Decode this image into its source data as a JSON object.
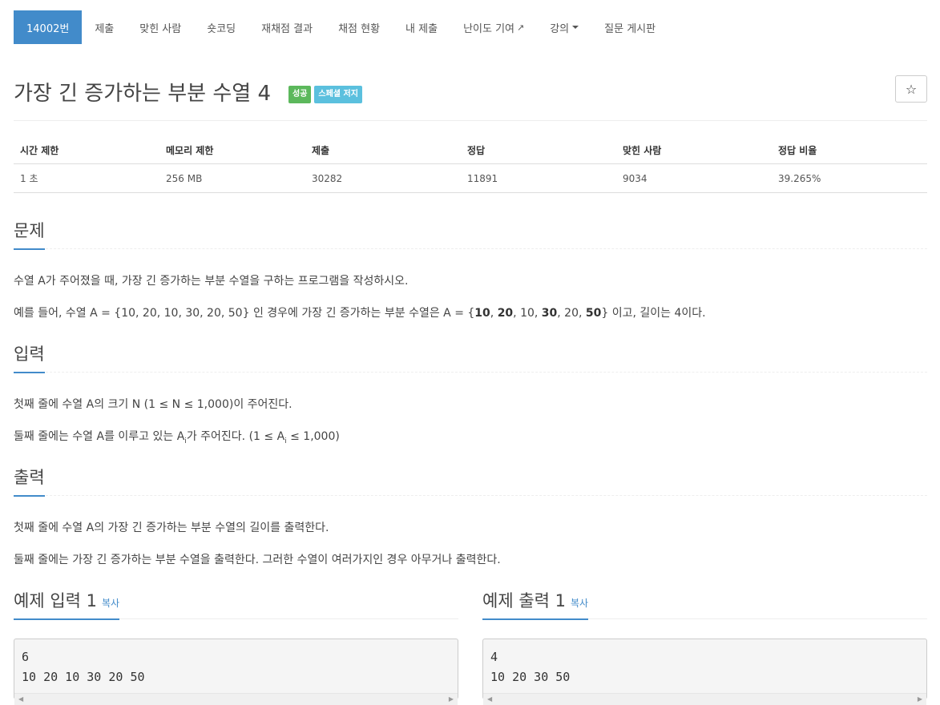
{
  "nav": {
    "problem_number": "14002번",
    "submit": "제출",
    "solvers": "맞힌 사람",
    "shortest": "숏코딩",
    "rejudge": "재채점 결과",
    "status": "채점 현황",
    "my_submissions": "내 제출",
    "difficulty": "난이도 기여",
    "lecture": "강의",
    "board": "질문 게시판"
  },
  "problem": {
    "title": "가장 긴 증가하는 부분 수열 4",
    "badge_success": "성공",
    "badge_special": "스페셜 저지"
  },
  "info_table": {
    "headers": [
      "시간 제한",
      "메모리 제한",
      "제출",
      "정답",
      "맞힌 사람",
      "정답 비율"
    ],
    "values": [
      "1 초",
      "256 MB",
      "30282",
      "11891",
      "9034",
      "39.265%"
    ]
  },
  "sections": {
    "description_title": "문제",
    "description_p1": "수열 A가 주어졌을 때, 가장 긴 증가하는 부분 수열을 구하는 프로그램을 작성하시오.",
    "description_p2_pre": "예를 들어, 수열 A = {10, 20, 10, 30, 20, 50} 인 경우에 가장 긴 증가하는 부분 수열은 A = {",
    "description_p2_b1": "10",
    "description_p2_s1": ", ",
    "description_p2_b2": "20",
    "description_p2_s2": ", 10, ",
    "description_p2_b3": "30",
    "description_p2_s3": ", 20, ",
    "description_p2_b4": "50",
    "description_p2_post": "} 이고, 길이는 4이다.",
    "input_title": "입력",
    "input_p1": "첫째 줄에 수열 A의 크기 N (1 ≤ N ≤ 1,000)이 주어진다.",
    "input_p2_pre": "둘째 줄에는 수열 A를 이루고 있는 A",
    "input_p2_sub": "i",
    "input_p2_mid": "가 주어진다. (1 ≤ A",
    "input_p2_sub2": "i",
    "input_p2_post": " ≤ 1,000)",
    "output_title": "출력",
    "output_p1": "첫째 줄에 수열 A의 가장 긴 증가하는 부분 수열의 길이를 출력한다.",
    "output_p2": "둘째 줄에는 가장 긴 증가하는 부분 수열을 출력한다. 그러한 수열이 여러가지인 경우 아무거나 출력한다."
  },
  "examples": {
    "input_title": "예제 입력 1",
    "output_title": "예제 출력 1",
    "copy_label": "복사",
    "input_text": "6\n10 20 10 30 20 50",
    "output_text": "4\n10 20 30 50"
  }
}
